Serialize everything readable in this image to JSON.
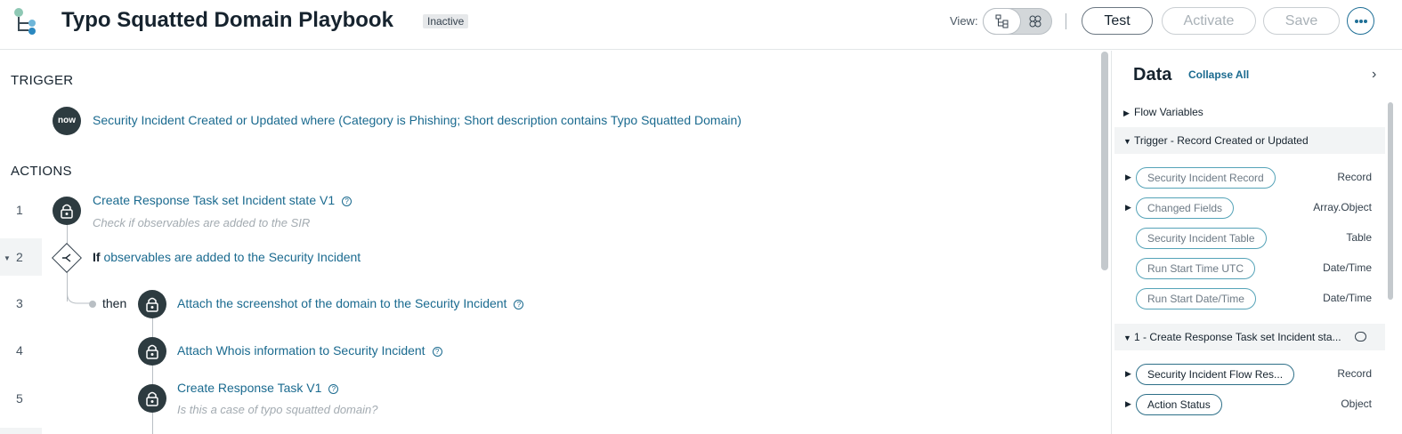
{
  "header": {
    "title": "Typo Squatted Domain Playbook",
    "status_badge": "Inactive",
    "view_label": "View:",
    "buttons": {
      "test": "Test",
      "activate": "Activate",
      "save": "Save"
    }
  },
  "trigger": {
    "heading": "TRIGGER",
    "icon_text": "now",
    "description": "Security Incident Created or Updated where (Category is Phishing; Short description contains Typo Squatted Domain)"
  },
  "actions": {
    "heading": "ACTIONS",
    "steps": [
      {
        "num": "1",
        "title": "Create Response Task set Incident state V1",
        "help": "?",
        "annotation": "Check if observables are added to the SIR"
      },
      {
        "num": "2",
        "keyword": "If",
        "condition": "observables are added to the Security Incident"
      },
      {
        "num": "3",
        "branch": "then",
        "title": "Attach the screenshot of the domain to the Security Incident",
        "help": "?"
      },
      {
        "num": "4",
        "title": "Attach Whois information to Security Incident",
        "help": "?"
      },
      {
        "num": "5",
        "title": "Create Response Task V1",
        "help": "?",
        "annotation": "Is this a case of typo squatted domain?"
      }
    ]
  },
  "data_panel": {
    "title": "Data",
    "collapse_all": "Collapse All",
    "groups": [
      {
        "label": "Flow Variables",
        "expanded": false
      },
      {
        "label": "Trigger - Record Created or Updated",
        "expanded": true,
        "items": [
          {
            "pill": "Security Incident Record",
            "type": "Record",
            "expandable": true
          },
          {
            "pill": "Changed Fields",
            "type": "Array.Object",
            "expandable": true
          },
          {
            "pill": "Security Incident Table",
            "type": "Table",
            "expandable": false
          },
          {
            "pill": "Run Start Time UTC",
            "type": "Date/Time",
            "expandable": false
          },
          {
            "pill": "Run Start Date/Time",
            "type": "Date/Time",
            "expandable": false
          }
        ]
      },
      {
        "label": "1 - Create Response Task set Incident sta...",
        "expanded": true,
        "items": [
          {
            "pill": "Security Incident Flow Res...",
            "type": "Record",
            "expandable": true
          },
          {
            "pill": "Action Status",
            "type": "Object",
            "expandable": true
          }
        ]
      }
    ]
  },
  "colors": {
    "accent": "#1a6a8f",
    "icon_bg": "#2d3b40",
    "pill_border": "#55a3b8"
  }
}
